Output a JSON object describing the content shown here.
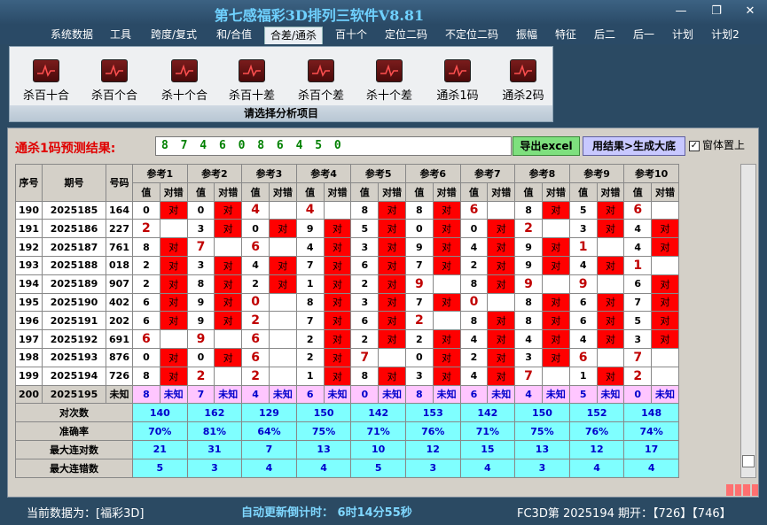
{
  "app": {
    "title": "第七感福彩3D排列三软件V8.81"
  },
  "window_controls": {
    "minimize": "—",
    "maximize": "❐",
    "close": "✕"
  },
  "menu": [
    "系统数据",
    "工具",
    "跨度/复式",
    "和/合值",
    "合差/通杀",
    "百十个",
    "定位二码",
    "不定位二码",
    "振幅",
    "特征",
    "后二",
    "后一",
    "计划",
    "计划2"
  ],
  "ribbon": {
    "buttons": [
      "杀百十合",
      "杀百个合",
      "杀十个合",
      "杀百十差",
      "杀百个差",
      "杀十个差",
      "通杀1码",
      "通杀2码"
    ],
    "caption": "请选择分析项目"
  },
  "prediction": {
    "label": "通杀1码预测结果:",
    "value": "8 7 4 6 0 8 6 4 5 0"
  },
  "buttons": {
    "excel": "导出excel",
    "generate": "用结果>生成大底",
    "topmost": "窗体置上"
  },
  "table": {
    "head": {
      "seq": "序号",
      "issue": "期号",
      "num": "号码",
      "val": "值",
      "right_wrong": "对错"
    },
    "refs": [
      "参考1",
      "参考2",
      "参考3",
      "参考4",
      "参考5",
      "参考6",
      "参考7",
      "参考8",
      "参考9",
      "参考10"
    ],
    "correct_mark": "对",
    "rows": [
      {
        "seq": "190",
        "issue": "2025185",
        "num": "164",
        "vals": [
          "0",
          "0",
          "4",
          "4",
          "8",
          "8",
          "6",
          "8",
          "5",
          "6"
        ],
        "ok": [
          true,
          true,
          false,
          false,
          true,
          true,
          false,
          true,
          true,
          false
        ]
      },
      {
        "seq": "191",
        "issue": "2025186",
        "num": "227",
        "vals": [
          "2",
          "3",
          "0",
          "9",
          "5",
          "0",
          "0",
          "2",
          "3",
          "4"
        ],
        "ok": [
          false,
          true,
          true,
          true,
          true,
          true,
          true,
          false,
          true,
          true
        ]
      },
      {
        "seq": "192",
        "issue": "2025187",
        "num": "761",
        "vals": [
          "8",
          "7",
          "6",
          "4",
          "3",
          "9",
          "4",
          "9",
          "1",
          "4"
        ],
        "ok": [
          true,
          false,
          false,
          true,
          true,
          true,
          true,
          true,
          false,
          true
        ]
      },
      {
        "seq": "193",
        "issue": "2025188",
        "num": "018",
        "vals": [
          "2",
          "3",
          "4",
          "7",
          "6",
          "7",
          "2",
          "9",
          "4",
          "1"
        ],
        "ok": [
          true,
          true,
          true,
          true,
          true,
          true,
          true,
          true,
          true,
          false
        ]
      },
      {
        "seq": "194",
        "issue": "2025189",
        "num": "907",
        "vals": [
          "2",
          "8",
          "2",
          "1",
          "2",
          "9",
          "8",
          "9",
          "9",
          "6"
        ],
        "ok": [
          true,
          true,
          true,
          true,
          true,
          false,
          true,
          false,
          false,
          true
        ]
      },
      {
        "seq": "195",
        "issue": "2025190",
        "num": "402",
        "vals": [
          "6",
          "9",
          "0",
          "8",
          "3",
          "7",
          "0",
          "8",
          "6",
          "7"
        ],
        "ok": [
          true,
          true,
          false,
          true,
          true,
          true,
          false,
          true,
          true,
          true
        ]
      },
      {
        "seq": "196",
        "issue": "2025191",
        "num": "202",
        "vals": [
          "6",
          "9",
          "2",
          "7",
          "6",
          "2",
          "8",
          "8",
          "6",
          "5"
        ],
        "ok": [
          true,
          true,
          false,
          true,
          true,
          false,
          true,
          true,
          true,
          true
        ]
      },
      {
        "seq": "197",
        "issue": "2025192",
        "num": "691",
        "vals": [
          "6",
          "9",
          "6",
          "2",
          "2",
          "2",
          "4",
          "4",
          "4",
          "3"
        ],
        "ok": [
          false,
          false,
          false,
          true,
          true,
          true,
          true,
          true,
          true,
          true
        ]
      },
      {
        "seq": "198",
        "issue": "2025193",
        "num": "876",
        "vals": [
          "0",
          "0",
          "6",
          "2",
          "7",
          "0",
          "2",
          "3",
          "6",
          "7"
        ],
        "ok": [
          true,
          true,
          false,
          true,
          false,
          true,
          true,
          true,
          false,
          false
        ]
      },
      {
        "seq": "199",
        "issue": "2025194",
        "num": "726",
        "vals": [
          "8",
          "2",
          "2",
          "1",
          "8",
          "3",
          "4",
          "7",
          "1",
          "2"
        ],
        "ok": [
          true,
          false,
          false,
          true,
          true,
          true,
          true,
          false,
          true,
          false
        ]
      }
    ],
    "last": {
      "seq": "200",
      "issue": "2025195",
      "num": "未知",
      "vals": [
        "8",
        "7",
        "4",
        "6",
        "0",
        "8",
        "6",
        "4",
        "5",
        "0"
      ],
      "unknown": "未知"
    },
    "stats": [
      {
        "label": "对次数",
        "vals": [
          "140",
          "162",
          "129",
          "150",
          "142",
          "153",
          "142",
          "150",
          "152",
          "148"
        ]
      },
      {
        "label": "准确率",
        "vals": [
          "70%",
          "81%",
          "64%",
          "75%",
          "71%",
          "76%",
          "71%",
          "75%",
          "76%",
          "74%"
        ]
      },
      {
        "label": "最大连对数",
        "vals": [
          "21",
          "31",
          "7",
          "13",
          "10",
          "12",
          "15",
          "13",
          "12",
          "17"
        ]
      },
      {
        "label": "最大连错数",
        "vals": [
          "5",
          "3",
          "4",
          "4",
          "5",
          "3",
          "4",
          "3",
          "4",
          "4"
        ]
      }
    ]
  },
  "status": {
    "current": "当前数据为：[福彩3D]",
    "countdown": "自动更新倒计时： 6时14分55秒",
    "issue": "FC3D第 2025194 期开：【726】【746】"
  },
  "colors": {
    "correct_bg": "#ff0000",
    "stats_bg": "#7fffff",
    "last_row_bg": "#ffc6ff",
    "title": "#6fd1ff"
  }
}
